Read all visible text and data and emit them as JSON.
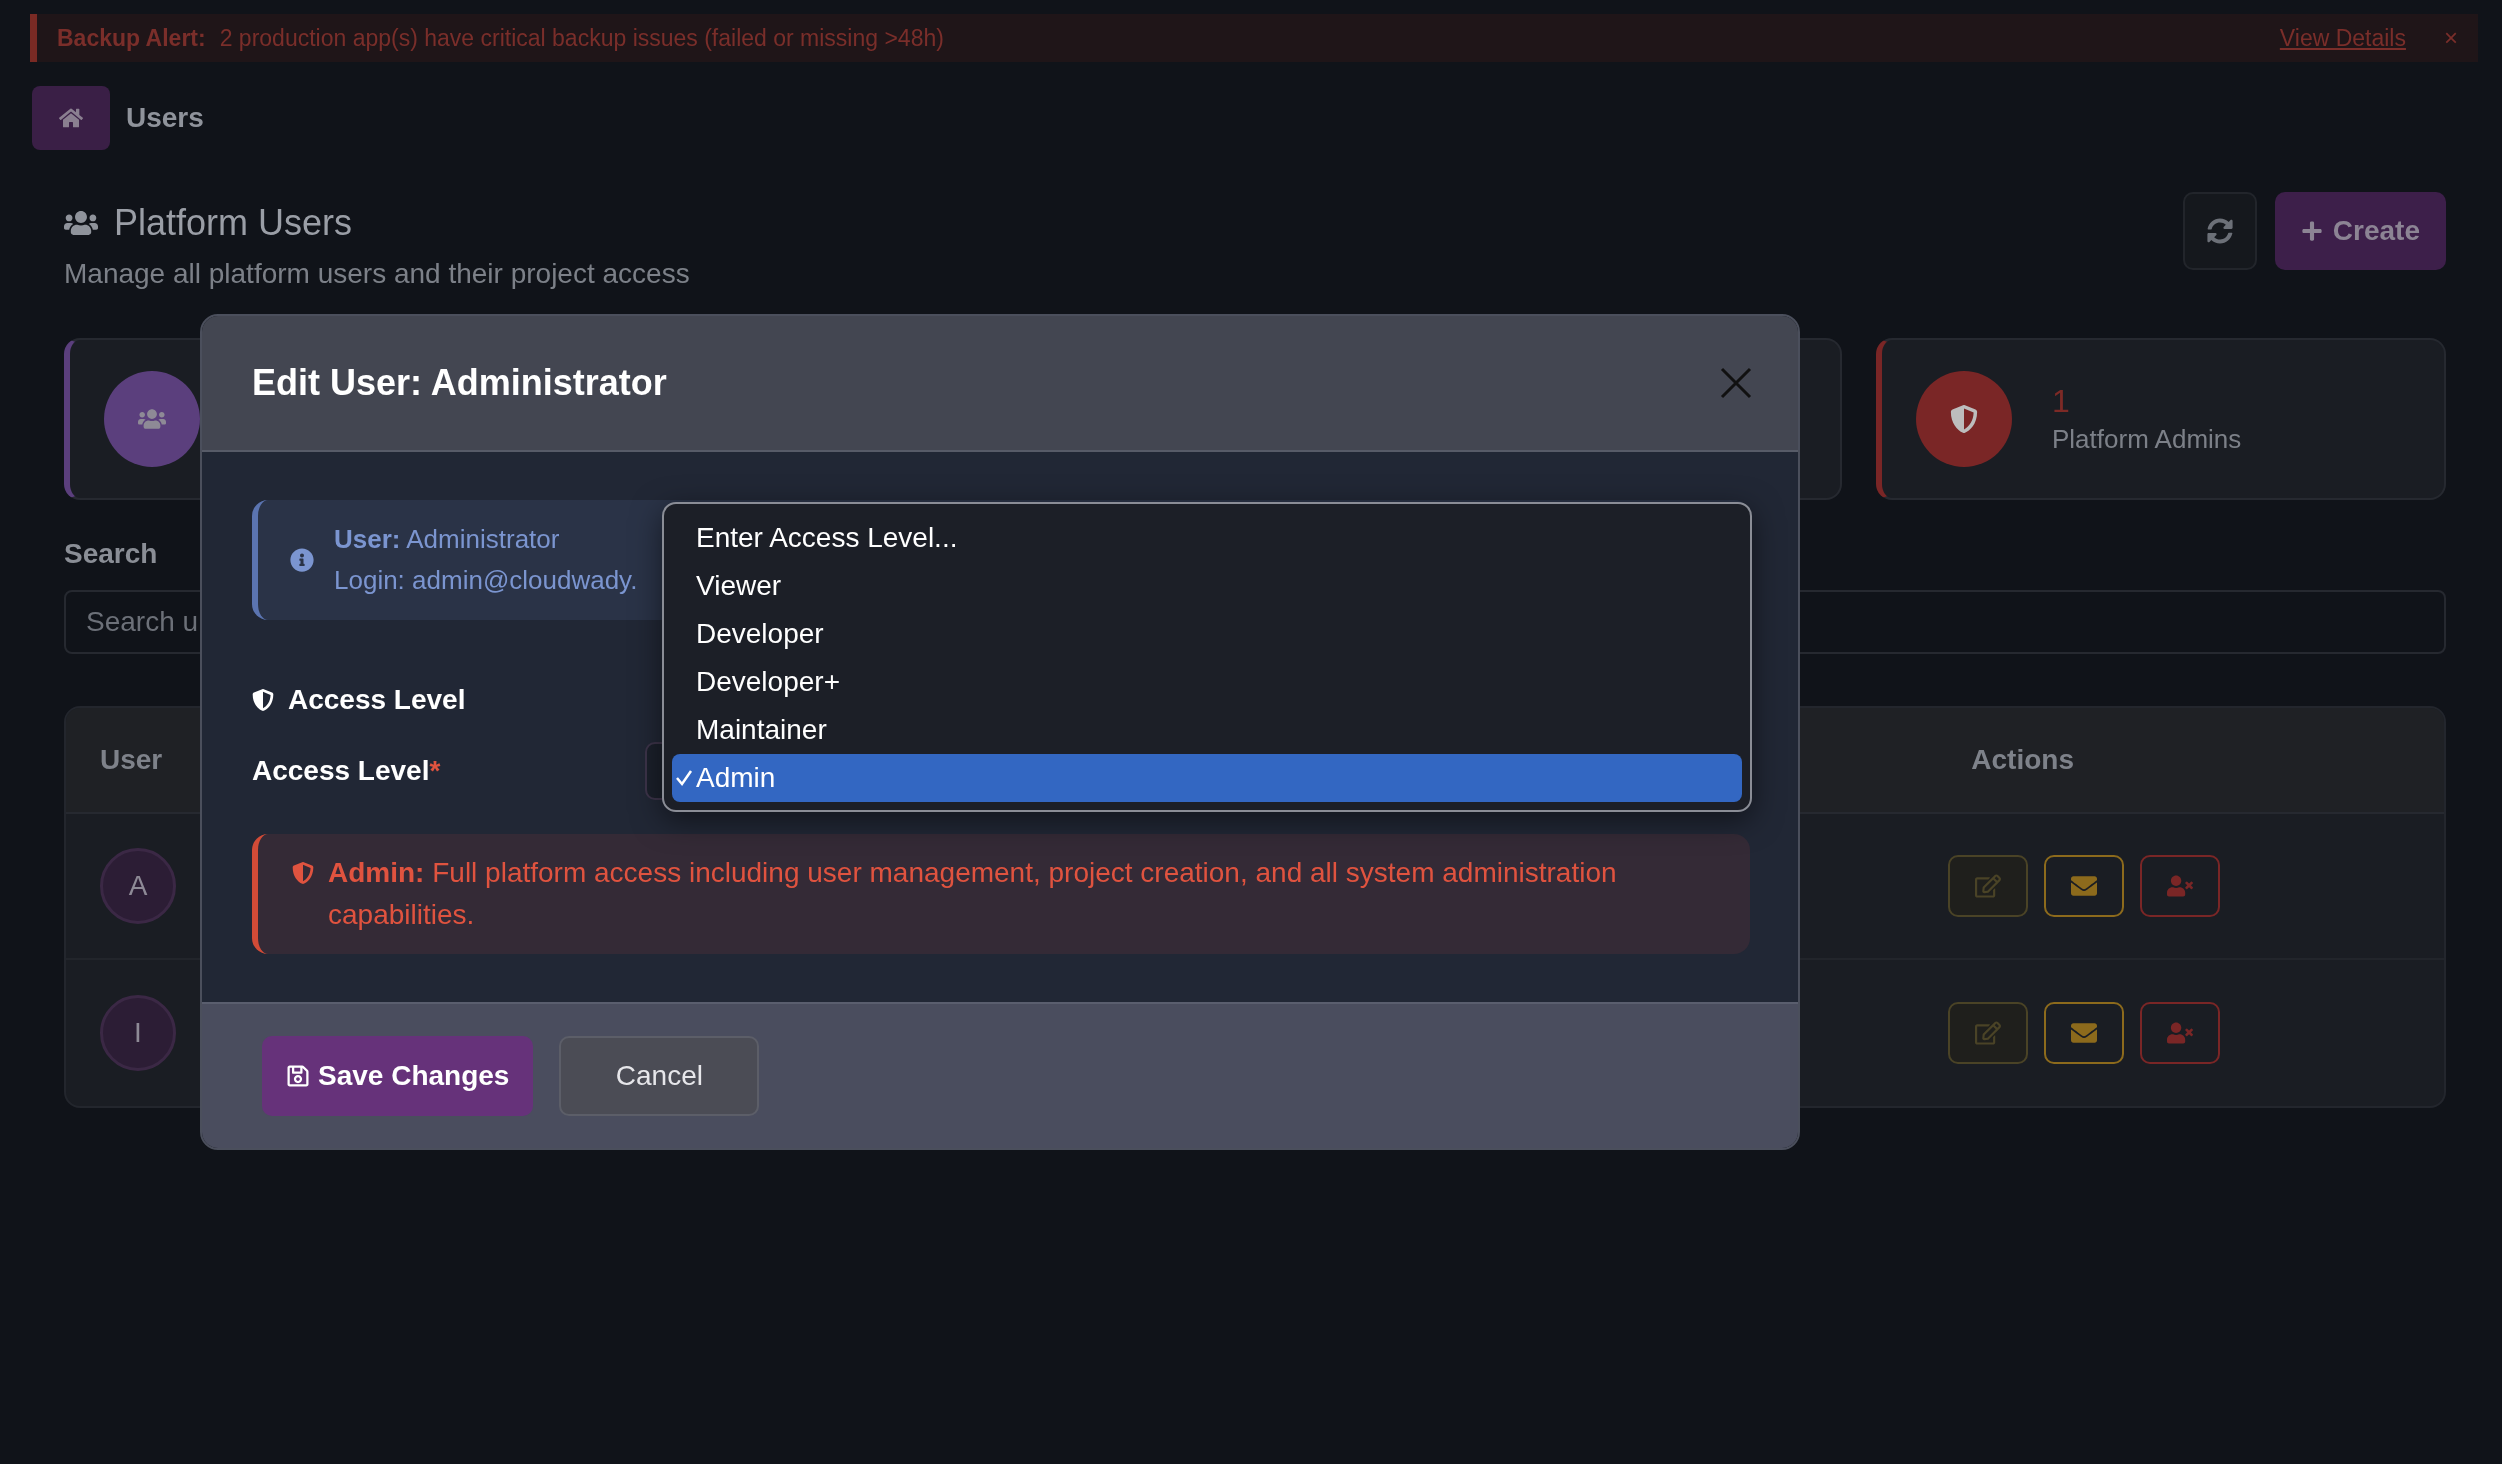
{
  "alert": {
    "title": "Backup Alert:",
    "message": "2 production app(s) have critical backup issues (failed or missing >48h)",
    "link": "View Details",
    "close": "×"
  },
  "breadcrumb": {
    "current": "Users"
  },
  "header": {
    "title": "Platform Users",
    "subtitle": "Manage all platform users and their project access",
    "create": "Create"
  },
  "stats": [
    {
      "kind": "users",
      "color": "#5b3f7d"
    },
    {
      "kind": "blank",
      "color": "#2a2d35"
    },
    {
      "kind": "admins",
      "color": "#7a2626",
      "value": "1",
      "label": "Platform Admins"
    }
  ],
  "search": {
    "label": "Search",
    "placeholder": "Search u"
  },
  "table": {
    "columns": [
      "User",
      "Actions"
    ],
    "rows": [
      {
        "avatar": "A"
      },
      {
        "avatar": "I"
      }
    ]
  },
  "modal": {
    "title": "Edit User: Administrator",
    "info": {
      "user_label": "User:",
      "user": "Administrator",
      "login": "Login: admin@cloudwady."
    },
    "section": "Access Level",
    "field_label": "Access Level",
    "required": "*",
    "options": [
      {
        "label": "Enter Access Level...",
        "selected": false
      },
      {
        "label": "Viewer",
        "selected": false
      },
      {
        "label": "Developer",
        "selected": false
      },
      {
        "label": "Developer+",
        "selected": false
      },
      {
        "label": "Maintainer",
        "selected": false
      },
      {
        "label": "Admin",
        "selected": true
      }
    ],
    "description": "**Admin:** Full platform access including user management, project creation, and all system administration capabilities.",
    "save": "Save Changes",
    "cancel": "Cancel"
  }
}
